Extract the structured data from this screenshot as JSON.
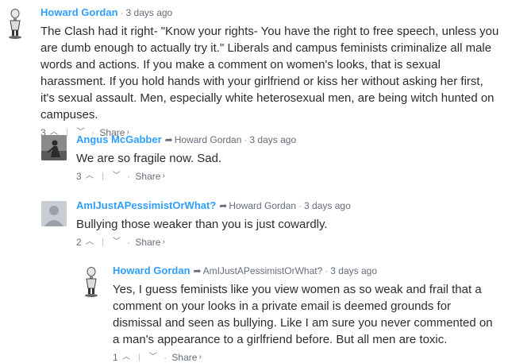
{
  "comments": [
    {
      "author": "Howard Gordan",
      "reply_to": "",
      "time": "3 days ago",
      "text": "The Clash had it right- \"Know your rights- You have the right to free speech, unless you are dumb enough to actually try it.\" Liberals and campus feminists criminalize all male words and actions. If you make a comment on women's looks, that is sexual harassment. If you hold hands with your girlfriend or kiss her without asking her first, it's sexual assault. Men, especially white heterosexual men, are being witch hunted on campuses.",
      "votes": "3",
      "share": "Share",
      "avatar_icon": "figure-avatar-icon"
    },
    {
      "author": "Angus McGabber",
      "reply_to": "Howard Gordan",
      "time": "3 days ago",
      "text": "We are so fragile now. Sad.",
      "votes": "3",
      "share": "Share",
      "avatar_icon": "photo-avatar-icon"
    },
    {
      "author": "AmIJustAPessimistOrWhat?",
      "reply_to": "Howard Gordan",
      "time": "3 days ago",
      "text": "Bullying those weaker than you is just cowardly.",
      "votes": "2",
      "share": "Share",
      "avatar_icon": "default-avatar-icon"
    },
    {
      "author": "Howard Gordan",
      "reply_to": "AmIJustAPessimistOrWhat?",
      "time": "3 days ago",
      "text": "Yes, I guess feminists like you view women as so weak and frail that a comment on your looks in a private email is deemed grounds for dismissal and seen as bullying. Like I am sure you never commented on a man's appearance to a girlfriend before. But all men are toxic.",
      "votes": "1",
      "share": "Share",
      "avatar_icon": "figure-avatar-icon"
    }
  ],
  "colors": {
    "author_link": "#2e9fff",
    "body_text": "#2a2e2e",
    "meta_text": "#656c7a"
  }
}
